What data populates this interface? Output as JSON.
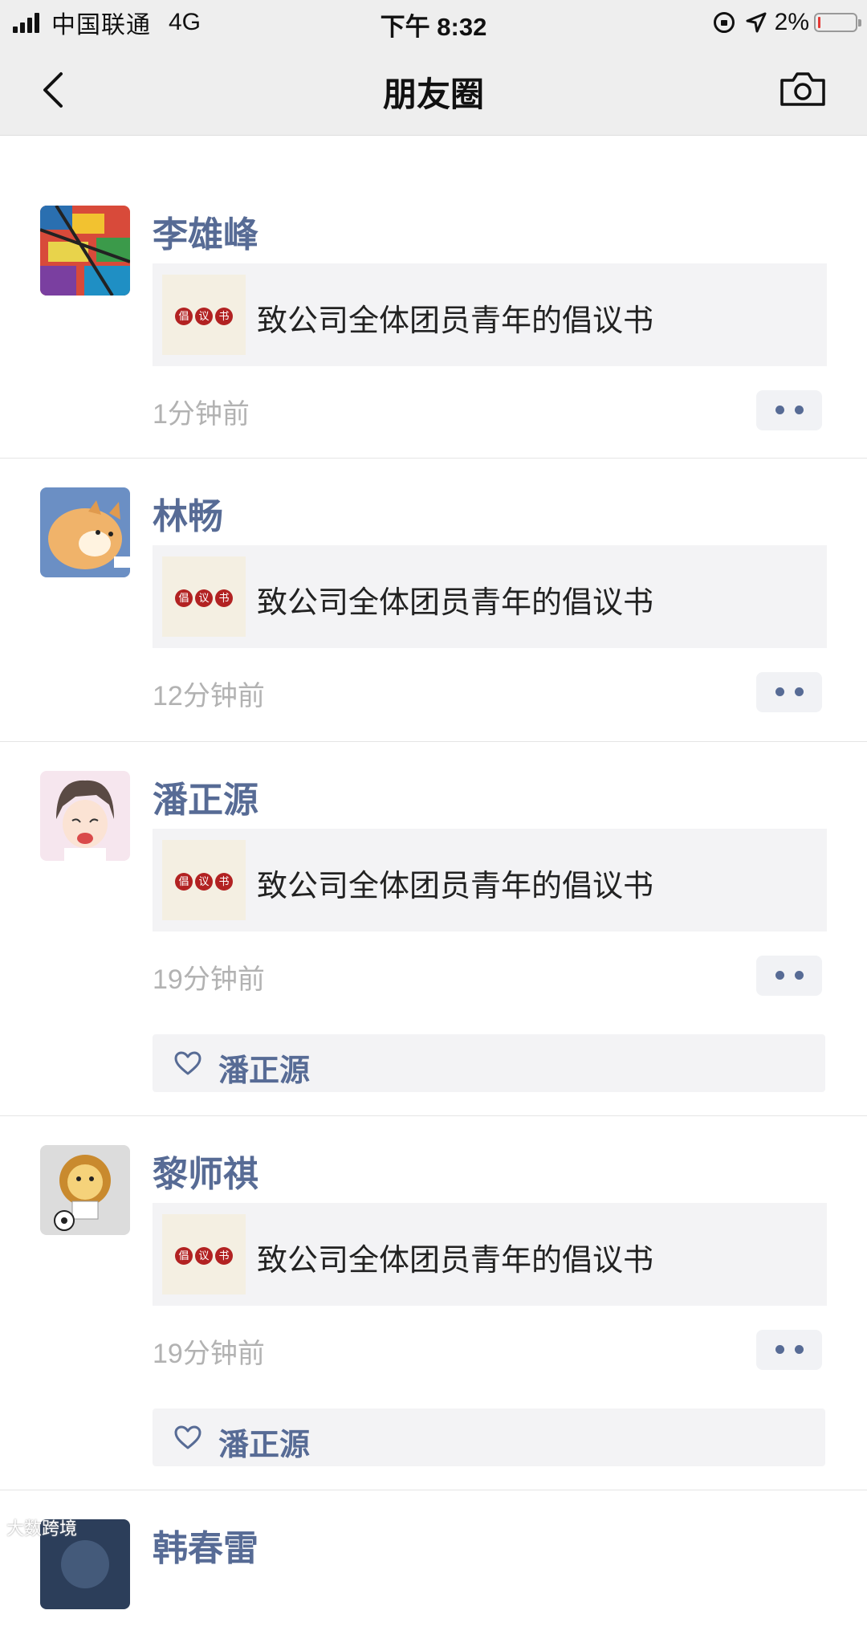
{
  "status_bar": {
    "carrier": "中国联通",
    "network": "4G",
    "time": "下午 8:32",
    "battery_percent": "2%",
    "battery_level": 0.02,
    "icons": [
      "signal-icon",
      "orientation-lock-icon",
      "location-icon",
      "battery-icon"
    ]
  },
  "nav": {
    "title": "朋友圈",
    "back_icon": "chevron-left-icon",
    "camera_icon": "camera-icon"
  },
  "posts": [
    {
      "name": "李雄峰",
      "share": {
        "thumb_text": [
          "倡",
          "议",
          "书"
        ],
        "title": "致公司全体团员青年的倡议书"
      },
      "time": "1分钟前",
      "likes": ""
    },
    {
      "name": "林畅",
      "share": {
        "thumb_text": [
          "倡",
          "议",
          "书"
        ],
        "title": "致公司全体团员青年的倡议书"
      },
      "time": "12分钟前",
      "likes": ""
    },
    {
      "name": "潘正源",
      "share": {
        "thumb_text": [
          "倡",
          "议",
          "书"
        ],
        "title": "致公司全体团员青年的倡议书"
      },
      "time": "19分钟前",
      "likes": "潘正源"
    },
    {
      "name": "黎师祺",
      "share": {
        "thumb_text": [
          "倡",
          "议",
          "书"
        ],
        "title": "致公司全体团员青年的倡议书"
      },
      "time": "19分钟前",
      "likes": "潘正源"
    },
    {
      "name": "韩春雷"
    }
  ],
  "watermark": "大数跨境",
  "colors": {
    "name_blue": "#576b95",
    "bar_gray": "#eeeeee",
    "card_gray": "#f3f3f5",
    "time_gray": "#b2b2b2",
    "battery_red": "#e53935"
  }
}
